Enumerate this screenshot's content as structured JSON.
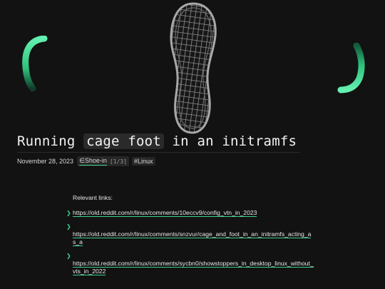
{
  "post": {
    "title_before": "Running",
    "title_code": "cage foot",
    "title_after": "in an initramfs",
    "date": "November 28, 2023",
    "series_label": "∈Shoe-in",
    "series_count": "[1/3]",
    "tag": "#Linux"
  },
  "hero": {
    "image": "shoe-sole-icon",
    "accent_color": "#3fd18c"
  },
  "content": {
    "intro": "Relevant links:",
    "links": [
      "https://old.reddit.com/r/linux/comments/10eccv9/config_vtn_in_2023",
      "https://old.reddit.com/r/linux/comments/snzvur/cage_and_foot_in_an_initramfs_acting_as_a",
      "https://old.reddit.com/r/linux/comments/sycbn0/showstoppers_in_desktop_linux_without_vts_in_2022"
    ]
  }
}
